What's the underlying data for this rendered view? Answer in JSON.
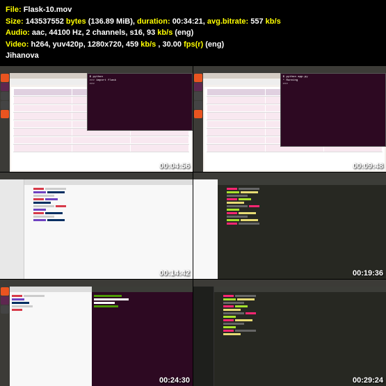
{
  "header": {
    "file_label": "File:",
    "file_value": "Flask-10.mov",
    "size_label": "Size:",
    "size_bytes": "143537552",
    "bytes_text": "bytes",
    "size_mib": "(136.89 MiB),",
    "duration_label": "duration:",
    "duration_value": "00:34:21,",
    "bitrate_label": "avg.bitrate:",
    "bitrate_value": "557",
    "bitrate_unit": "kb/s",
    "audio_label": "Audio:",
    "audio_value": "aac, 44100 Hz, 2 channels, s16, 93",
    "audio_end": "(eng)",
    "video_label": "Video:",
    "video_value": "h264, yuv420p, 1280x720, 459",
    "video_fps": ", 30.00",
    "fps_label": "fps(r)",
    "video_end": "(eng)",
    "author": "Jihanova"
  },
  "thumbnails": [
    {
      "timestamp": "00:04:56"
    },
    {
      "timestamp": "00:09:48"
    },
    {
      "timestamp": "00:14:42"
    },
    {
      "timestamp": "00:19:36"
    },
    {
      "timestamp": "00:24:30"
    },
    {
      "timestamp": "00:29:24"
    }
  ]
}
